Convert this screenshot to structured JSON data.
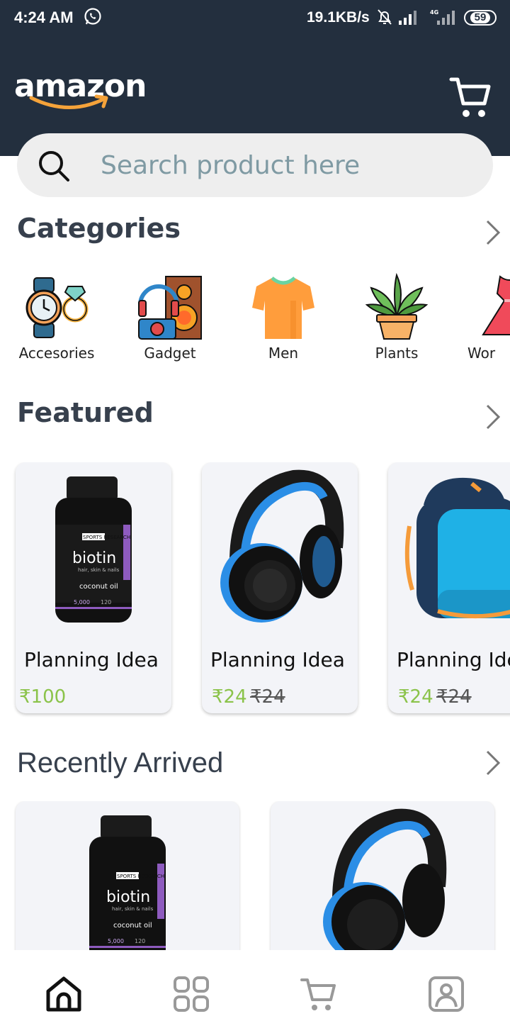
{
  "status": {
    "time": "4:24 AM",
    "speed": "19.1KB/s",
    "network": "4G",
    "battery": "59"
  },
  "header": {
    "logo_text": "amazon",
    "cart_icon": "cart-icon"
  },
  "search": {
    "placeholder": "Search product here",
    "value": ""
  },
  "categories": {
    "title": "Categories",
    "items": [
      {
        "label": "Accesories",
        "icon": "watch-ring-icon"
      },
      {
        "label": "Gadget",
        "icon": "gadget-icon"
      },
      {
        "label": "Men",
        "icon": "tshirt-icon"
      },
      {
        "label": "Plants",
        "icon": "plant-icon"
      },
      {
        "label": "Wor",
        "icon": "dress-icon"
      }
    ]
  },
  "featured": {
    "title": "Featured",
    "items": [
      {
        "name": "Planning Idea",
        "price": "₹100",
        "old_price": "",
        "image": "biotin-bottle"
      },
      {
        "name": "Planning Idea",
        "price": "₹24",
        "old_price": "₹24",
        "image": "headphones"
      },
      {
        "name": "Planning Idea",
        "price": "₹24",
        "old_price": "₹24",
        "image": "backpack"
      }
    ]
  },
  "recent": {
    "title": "Recently Arrived",
    "items": [
      {
        "image": "biotin-bottle"
      },
      {
        "image": "headphones"
      }
    ]
  },
  "bottom_nav": [
    {
      "name": "home",
      "icon": "home-icon",
      "active": true
    },
    {
      "name": "categories",
      "icon": "grid-icon",
      "active": false
    },
    {
      "name": "cart",
      "icon": "cart-icon",
      "active": false
    },
    {
      "name": "profile",
      "icon": "profile-icon",
      "active": false
    }
  ],
  "colors": {
    "header_bg": "#232f3e",
    "accent_green": "#8bc34a",
    "logo_orange": "#f5a33a"
  },
  "bottle_label": {
    "brand": "SPORTS RESEARCH",
    "product": "biotin",
    "tagline": "hair, skin & nails",
    "made_with": "coconut oil",
    "dose": "5,000",
    "count": "120"
  }
}
